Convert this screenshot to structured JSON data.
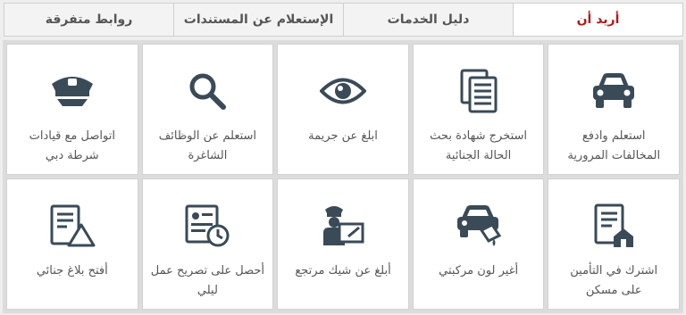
{
  "tabs": [
    {
      "label": "أريد أن"
    },
    {
      "label": "دليل الخدمات"
    },
    {
      "label": "الإستعلام عن المستندات"
    },
    {
      "label": "روابط متفرقة"
    }
  ],
  "colors": {
    "accent": "#b01a1a",
    "icon": "#3a4a57"
  },
  "services": [
    {
      "icon": "car-icon",
      "label": "استعلم وادفع\nالمخالفات المرورية"
    },
    {
      "icon": "documents-icon",
      "label": "استخرج شهادة بحث\nالحالة الجنائية"
    },
    {
      "icon": "eye-icon",
      "label": "ابلغ عن جريمة"
    },
    {
      "icon": "search-icon",
      "label": "استعلم عن الوظائف\nالشاغرة"
    },
    {
      "icon": "police-cap-icon",
      "label": "اتواصل مع قيادات\nشرطة دبي"
    },
    {
      "icon": "house-insurance-icon",
      "label": "اشترك في التأمين\nعلى مسكن"
    },
    {
      "icon": "car-paint-icon",
      "label": "أغير لون مركبتي"
    },
    {
      "icon": "police-cheque-icon",
      "label": "أبلغ عن شيك مرتجع"
    },
    {
      "icon": "permit-clock-icon",
      "label": "أحصل على تصريح عمل\nليلي"
    },
    {
      "icon": "report-warning-icon",
      "label": "أفتح بلاغ جنائي"
    }
  ]
}
